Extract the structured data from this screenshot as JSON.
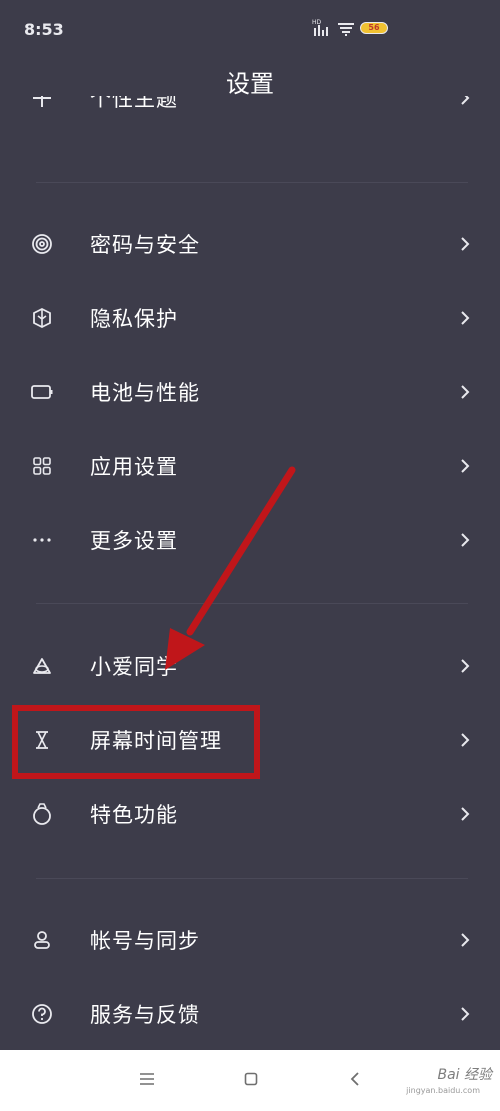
{
  "status": {
    "time": "8:53",
    "network_badge": "HD",
    "battery_label": "56"
  },
  "header": {
    "title": "设置"
  },
  "partial_item": {
    "label": "个性主题"
  },
  "groups": [
    [
      {
        "label": "密码与安全",
        "icon": "fingerprint-icon"
      },
      {
        "label": "隐私保护",
        "icon": "privacy-shield-icon"
      },
      {
        "label": "电池与性能",
        "icon": "battery-icon"
      },
      {
        "label": "应用设置",
        "icon": "apps-grid-icon"
      },
      {
        "label": "更多设置",
        "icon": "more-dots-icon"
      }
    ],
    [
      {
        "label": "小爱同学",
        "icon": "xiaoai-icon"
      },
      {
        "label": "屏幕时间管理",
        "icon": "hourglass-icon"
      },
      {
        "label": "特色功能",
        "icon": "special-features-icon"
      }
    ],
    [
      {
        "label": "帐号与同步",
        "icon": "account-icon"
      },
      {
        "label": "服务与反馈",
        "icon": "help-icon"
      }
    ]
  ],
  "watermark": {
    "text": "Bai 经验",
    "sub": "jingyan.baidu.com"
  },
  "colors": {
    "background": "#3d3c4a",
    "highlight": "#c0161a",
    "navbar": "#ffffff"
  }
}
